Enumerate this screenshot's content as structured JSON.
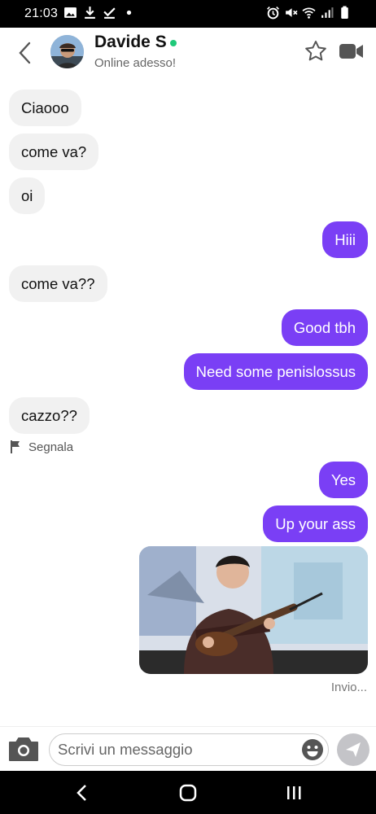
{
  "status_bar": {
    "time": "21:03",
    "left_icons": [
      "gallery-icon",
      "download-icon",
      "check-download-icon",
      "dot-icon"
    ],
    "right_icons": [
      "alarm-icon",
      "mute-icon",
      "wifi-icon",
      "signal-icon",
      "battery-icon"
    ]
  },
  "header": {
    "name": "Davide S",
    "status": "Online adesso!",
    "online_color": "#20c97a"
  },
  "messages": [
    {
      "dir": "in",
      "text": "Ciaooo"
    },
    {
      "dir": "in",
      "text": "come va?"
    },
    {
      "dir": "in",
      "text": "oi"
    },
    {
      "dir": "out",
      "text": "Hiii"
    },
    {
      "dir": "in",
      "text": "come va??"
    },
    {
      "dir": "out",
      "text": "Good tbh"
    },
    {
      "dir": "out",
      "text": "Need some penislossus"
    },
    {
      "dir": "in",
      "text": "cazzo??"
    },
    {
      "dir": "out",
      "text": "Yes"
    },
    {
      "dir": "out",
      "text": "Up your ass"
    }
  ],
  "report_label": "Segnala",
  "media_status": "Invio...",
  "composer": {
    "placeholder": "Scrivi un messaggio"
  },
  "colors": {
    "outgoing_bubble": "#7a3ff5",
    "incoming_bubble": "#f1f1f1"
  }
}
